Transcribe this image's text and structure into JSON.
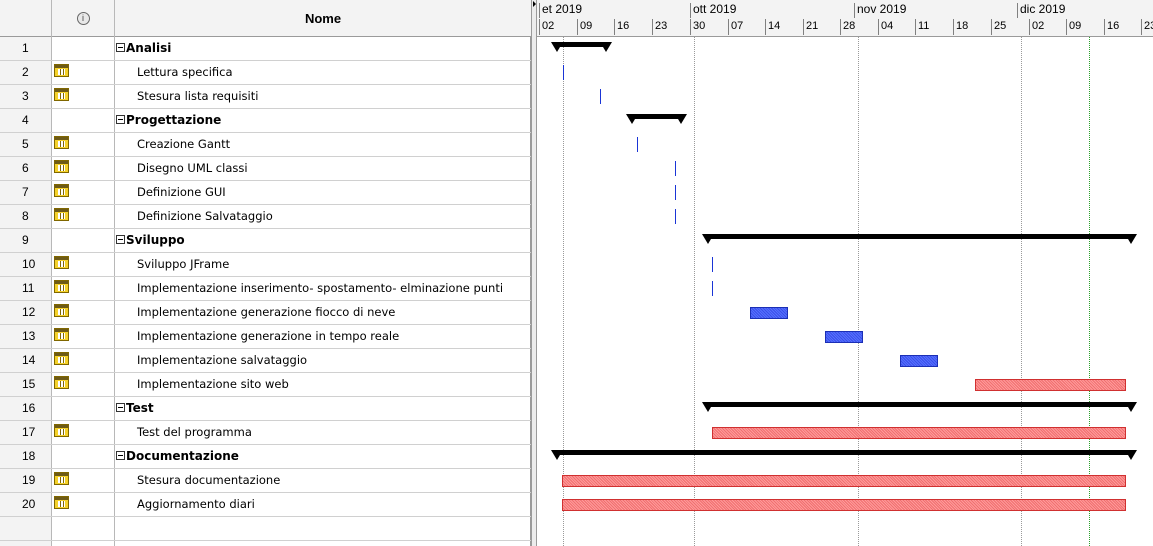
{
  "grid": {
    "header": {
      "info_icon": "info-icon",
      "name_label": "Nome"
    },
    "rows": [
      {
        "num": "1",
        "name": "Analisi",
        "type": "summary"
      },
      {
        "num": "2",
        "name": "Lettura specifica",
        "type": "task"
      },
      {
        "num": "3",
        "name": "Stesura lista requisiti",
        "type": "task"
      },
      {
        "num": "4",
        "name": "Progettazione",
        "type": "summary"
      },
      {
        "num": "5",
        "name": "Creazione Gantt",
        "type": "task"
      },
      {
        "num": "6",
        "name": "Disegno UML classi",
        "type": "task"
      },
      {
        "num": "7",
        "name": "Definizione GUI",
        "type": "task"
      },
      {
        "num": "8",
        "name": "Definizione Salvataggio",
        "type": "task"
      },
      {
        "num": "9",
        "name": "Sviluppo",
        "type": "summary"
      },
      {
        "num": "10",
        "name": "Sviluppo JFrame",
        "type": "task"
      },
      {
        "num": "11",
        "name": "Implementazione inserimento- spostamento- elminazione punti",
        "type": "task"
      },
      {
        "num": "12",
        "name": "Implementazione generazione fiocco di neve",
        "type": "task"
      },
      {
        "num": "13",
        "name": "Implementazione generazione in tempo reale",
        "type": "task"
      },
      {
        "num": "14",
        "name": "Implementazione salvataggio",
        "type": "task"
      },
      {
        "num": "15",
        "name": "Implementazione sito web",
        "type": "task"
      },
      {
        "num": "16",
        "name": "Test",
        "type": "summary"
      },
      {
        "num": "17",
        "name": "Test del programma",
        "type": "task"
      },
      {
        "num": "18",
        "name": "Documentazione",
        "type": "summary"
      },
      {
        "num": "19",
        "name": "Stesura documentazione",
        "type": "task"
      },
      {
        "num": "20",
        "name": "Aggiornamento diari",
        "type": "task"
      }
    ]
  },
  "timeline": {
    "months": [
      "et 2019",
      "ott 2019",
      "nov 2019",
      "dic 2019"
    ],
    "weeks": [
      "02",
      "09",
      "16",
      "23",
      "30",
      "07",
      "14",
      "21",
      "28",
      "04",
      "11",
      "18",
      "25",
      "02",
      "09",
      "16",
      "23"
    ],
    "colors": {
      "summary": "#000000",
      "task_blue": "#3a4fe8",
      "task_red": "#f07070",
      "today": "#2ca02c"
    }
  }
}
